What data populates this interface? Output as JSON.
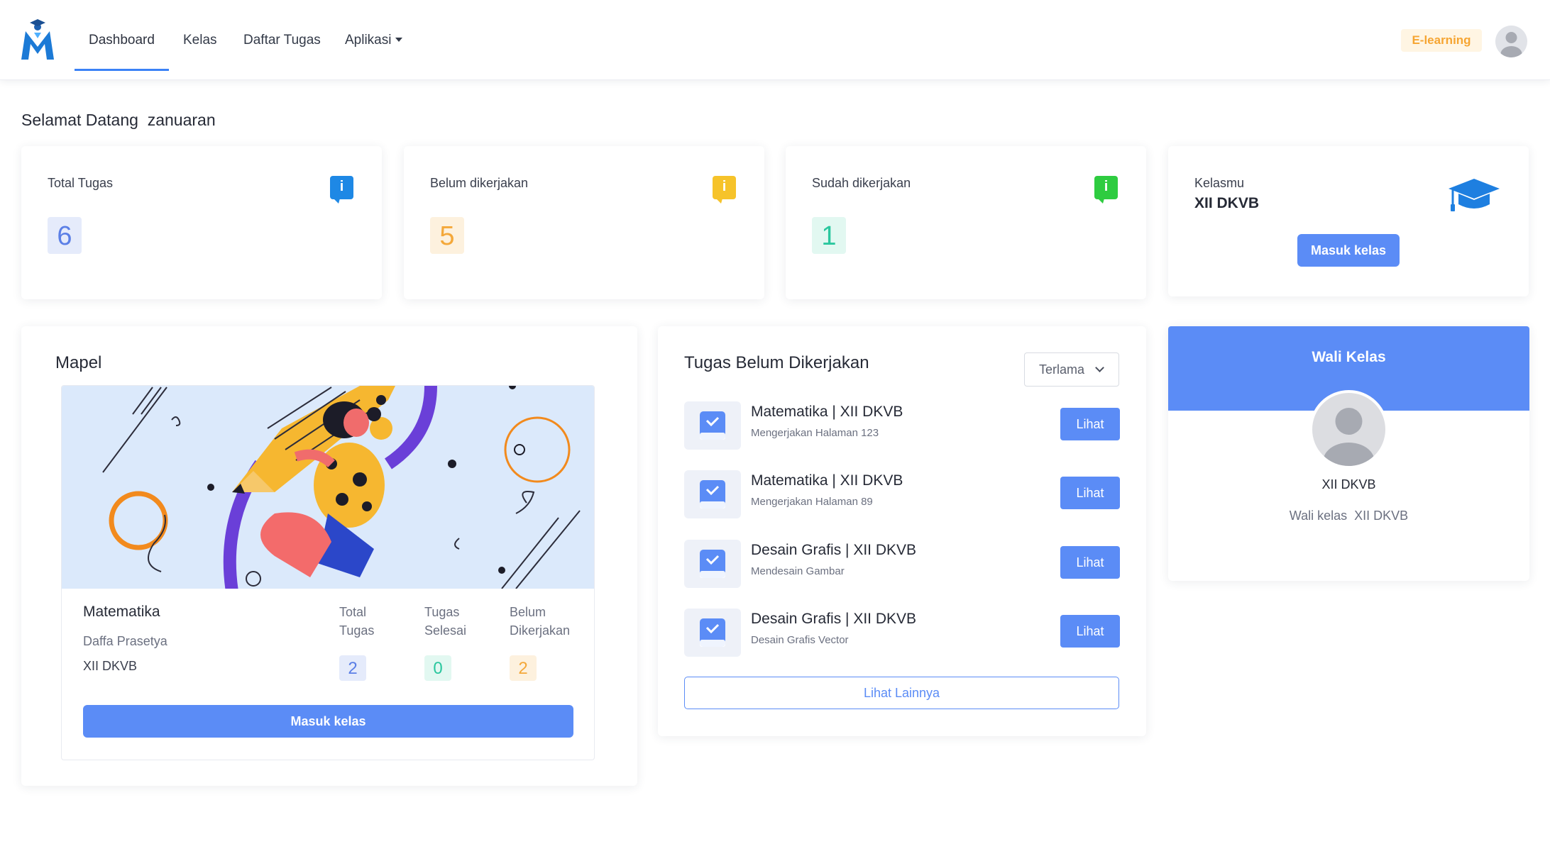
{
  "colors": {
    "accent": "#5b8cf6",
    "info_blue": "#1e88e5",
    "warning_yellow": "#f6c32a",
    "success_green": "#2ecc40",
    "badge_orange": "#f6a532"
  },
  "navbar": {
    "logo_icon": "school-logo-icon",
    "items": [
      {
        "label": "Dashboard",
        "active": true
      },
      {
        "label": "Kelas"
      },
      {
        "label": "Daftar Tugas"
      },
      {
        "label": "Aplikasi"
      }
    ],
    "badge": "E-learning",
    "avatar_icon": "user-avatar-icon"
  },
  "welcome": "Selamat Datang  zanuaran",
  "stats": [
    {
      "label": "Total Tugas",
      "value": "6",
      "icon": "info-icon"
    },
    {
      "label": "Belum dikerjakan",
      "value": "5",
      "icon": "info-icon"
    },
    {
      "label": "Sudah dikerjakan",
      "value": "1",
      "icon": "info-icon"
    }
  ],
  "kelasmu": {
    "label": "Kelasmu",
    "class_name": "XII DKVB",
    "button": "Masuk kelas",
    "icon": "graduation-cap-icon"
  },
  "mapel": {
    "title": "Mapel",
    "subject": "Matematika",
    "teacher": "Daffa Prasetya",
    "class_name": "XII DKVB",
    "columns": [
      {
        "label": "Total Tugas",
        "value": "2"
      },
      {
        "label": "Tugas Selesai",
        "value": "0"
      },
      {
        "label": "Belum Dikerjakan",
        "value": "2"
      }
    ],
    "button": "Masuk kelas"
  },
  "tugas": {
    "title": "Tugas Belum Dikerjakan",
    "sort_selected": "Terlama",
    "items": [
      {
        "title": "Matematika | XII DKVB",
        "desc": "Mengerjakan Halaman 123",
        "button": "Lihat"
      },
      {
        "title": "Matematika | XII DKVB",
        "desc": "Mengerjakan Halaman 89",
        "button": "Lihat"
      },
      {
        "title": "Desain Grafis | XII DKVB",
        "desc": "Mendesain Gambar",
        "button": "Lihat"
      },
      {
        "title": "Desain Grafis | XII DKVB",
        "desc": "Desain Grafis Vector",
        "button": "Lihat"
      }
    ],
    "more_button": "Lihat Lainnya"
  },
  "wali": {
    "title": "Wali Kelas",
    "name": "XII DKVB",
    "description": "Wali kelas  XII DKVB"
  }
}
